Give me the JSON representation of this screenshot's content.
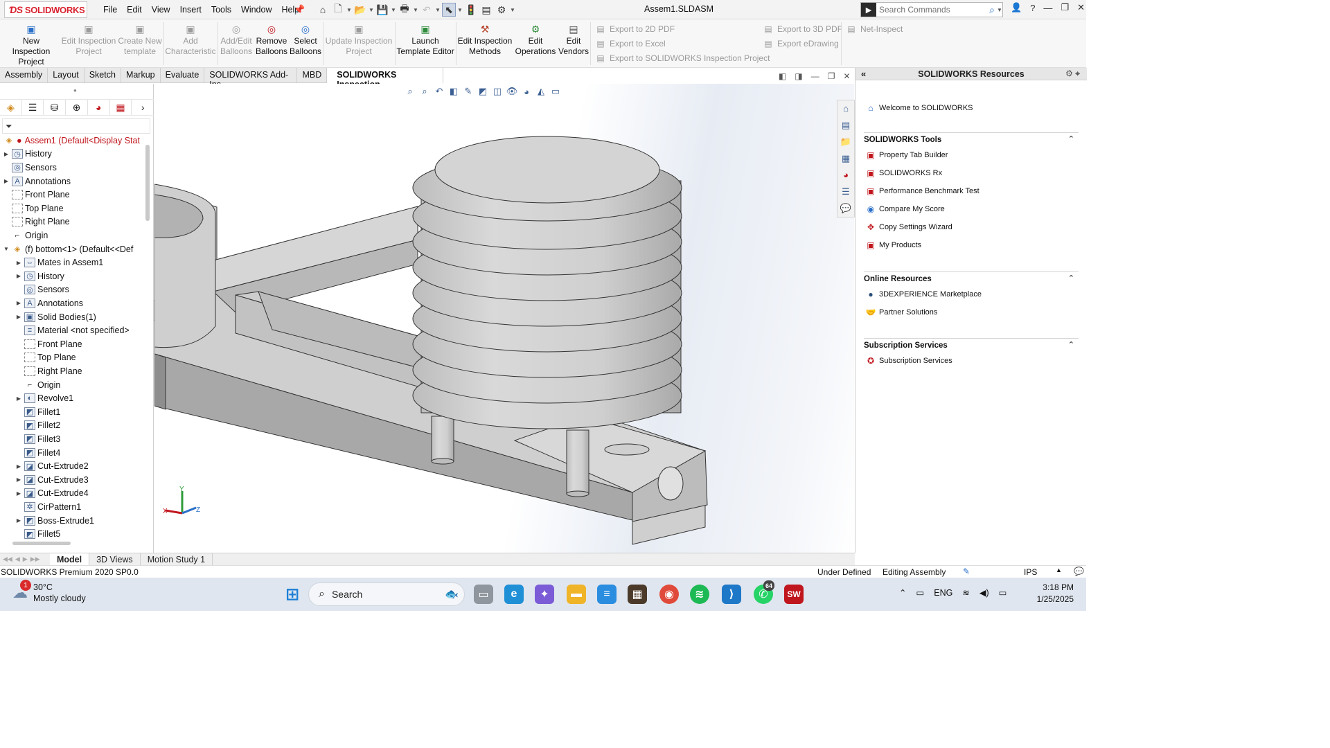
{
  "title_bar": {
    "logo_text": "SOLIDWORKS",
    "menus": [
      "File",
      "Edit",
      "View",
      "Insert",
      "Tools",
      "Window",
      "Help"
    ],
    "document_title": "Assem1.SLDASM",
    "search_placeholder": "Search Commands"
  },
  "command_manager": {
    "buttons": [
      {
        "label": "New Inspection Project",
        "line1": "New Inspection",
        "line2": "Project",
        "enabled": true
      },
      {
        "label": "Edit Inspection Project",
        "line1": "Edit Inspection",
        "line2": "Project",
        "enabled": false
      },
      {
        "label": "Create New template",
        "line1": "Create New",
        "line2": "template",
        "enabled": false
      },
      {
        "label": "Add Characteristic",
        "line1": "Add",
        "line2": "Characteristic",
        "enabled": false
      },
      {
        "label": "Add/Edit Balloons",
        "line1": "Add/Edit",
        "line2": "Balloons",
        "enabled": false
      },
      {
        "label": "Remove Balloons",
        "line1": "Remove",
        "line2": "Balloons",
        "enabled": true
      },
      {
        "label": "Select Balloons",
        "line1": "Select",
        "line2": "Balloons",
        "enabled": true
      },
      {
        "label": "Update Inspection Project",
        "line1": "Update Inspection",
        "line2": "Project",
        "enabled": false
      },
      {
        "label": "Launch Template Editor",
        "line1": "Launch",
        "line2": "Template Editor",
        "enabled": true
      },
      {
        "label": "Edit Inspection Methods",
        "line1": "Edit Inspection",
        "line2": "Methods",
        "enabled": true
      },
      {
        "label": "Edit Operations",
        "line1": "Edit",
        "line2": "Operations",
        "enabled": true
      },
      {
        "label": "Edit Vendors",
        "line1": "Edit",
        "line2": "Vendors",
        "enabled": true
      }
    ],
    "export_col1": [
      "Export to 2D PDF",
      "Export to Excel",
      "Export to SOLIDWORKS Inspection Project"
    ],
    "export_col2": [
      "Export to 3D PDF",
      "Export eDrawing"
    ],
    "net_inspect": "Net-Inspect"
  },
  "tabs": [
    "Assembly",
    "Layout",
    "Sketch",
    "Markup",
    "Evaluate",
    "SOLIDWORKS Add-Ins",
    "MBD",
    "SOLIDWORKS Inspection"
  ],
  "active_tab": "SOLIDWORKS Inspection",
  "feature_tree": {
    "root": "Assem1  (Default<Display Stat",
    "items": [
      {
        "label": "History",
        "indent": 1,
        "expand": true,
        "icon": "history-icon"
      },
      {
        "label": "Sensors",
        "indent": 1,
        "expand": false,
        "icon": "sensor-icon"
      },
      {
        "label": "Annotations",
        "indent": 1,
        "expand": true,
        "icon": "annotation-icon"
      },
      {
        "label": "Front Plane",
        "indent": 1,
        "expand": false,
        "icon": "plane-icon"
      },
      {
        "label": "Top Plane",
        "indent": 1,
        "expand": false,
        "icon": "plane-icon"
      },
      {
        "label": "Right Plane",
        "indent": 1,
        "expand": false,
        "icon": "plane-icon"
      },
      {
        "label": "Origin",
        "indent": 1,
        "expand": false,
        "icon": "origin-icon"
      },
      {
        "label": "(f) bottom<1> (Default<<Def",
        "indent": 1,
        "expand": true,
        "icon": "part-icon",
        "open": true
      },
      {
        "label": "Mates in Assem1",
        "indent": 2,
        "expand": true,
        "icon": "mates-icon"
      },
      {
        "label": "History",
        "indent": 2,
        "expand": true,
        "icon": "history-icon"
      },
      {
        "label": "Sensors",
        "indent": 2,
        "expand": false,
        "icon": "sensor-icon"
      },
      {
        "label": "Annotations",
        "indent": 2,
        "expand": true,
        "icon": "annotation-icon"
      },
      {
        "label": "Solid Bodies(1)",
        "indent": 2,
        "expand": true,
        "icon": "solid-bodies-icon"
      },
      {
        "label": "Material <not specified>",
        "indent": 2,
        "expand": false,
        "icon": "material-icon"
      },
      {
        "label": "Front Plane",
        "indent": 2,
        "expand": false,
        "icon": "plane-icon"
      },
      {
        "label": "Top Plane",
        "indent": 2,
        "expand": false,
        "icon": "plane-icon"
      },
      {
        "label": "Right Plane",
        "indent": 2,
        "expand": false,
        "icon": "plane-icon"
      },
      {
        "label": "Origin",
        "indent": 2,
        "expand": false,
        "icon": "origin-icon"
      },
      {
        "label": "Revolve1",
        "indent": 2,
        "expand": true,
        "icon": "revolve-icon"
      },
      {
        "label": "Fillet1",
        "indent": 2,
        "expand": false,
        "icon": "fillet-icon"
      },
      {
        "label": "Fillet2",
        "indent": 2,
        "expand": false,
        "icon": "fillet-icon"
      },
      {
        "label": "Fillet3",
        "indent": 2,
        "expand": false,
        "icon": "fillet-icon"
      },
      {
        "label": "Fillet4",
        "indent": 2,
        "expand": false,
        "icon": "fillet-icon"
      },
      {
        "label": "Cut-Extrude2",
        "indent": 2,
        "expand": true,
        "icon": "cut-extrude-icon"
      },
      {
        "label": "Cut-Extrude3",
        "indent": 2,
        "expand": true,
        "icon": "cut-extrude-icon"
      },
      {
        "label": "Cut-Extrude4",
        "indent": 2,
        "expand": true,
        "icon": "cut-extrude-icon"
      },
      {
        "label": "CirPattern1",
        "indent": 2,
        "expand": false,
        "icon": "circular-pattern-icon"
      },
      {
        "label": "Boss-Extrude1",
        "indent": 2,
        "expand": true,
        "icon": "boss-extrude-icon"
      },
      {
        "label": "Fillet5",
        "indent": 2,
        "expand": false,
        "icon": "fillet-icon"
      }
    ]
  },
  "resources": {
    "title": "SOLIDWORKS Resources",
    "welcome": "Welcome to SOLIDWORKS",
    "sections": [
      {
        "title": "SOLIDWORKS Tools",
        "items": [
          "Property Tab Builder",
          "SOLIDWORKS Rx",
          "Performance Benchmark Test",
          "Compare My Score",
          "Copy Settings Wizard",
          "My Products"
        ]
      },
      {
        "title": "Online Resources",
        "items": [
          "3DEXPERIENCE Marketplace",
          "Partner Solutions"
        ]
      },
      {
        "title": "Subscription Services",
        "items": [
          "Subscription Services"
        ]
      }
    ]
  },
  "bottom_tabs": [
    "Model",
    "3D Views",
    "Motion Study 1"
  ],
  "active_bottom_tab": "Model",
  "status_bar": {
    "left": "SOLIDWORKS Premium 2020 SP0.0",
    "under_defined": "Under Defined",
    "editing": "Editing Assembly",
    "units": "IPS"
  },
  "taskbar": {
    "weather_temp": "30°C",
    "weather_text": "Mostly cloudy",
    "weather_badge": "1",
    "search_label": "Search",
    "language": "ENG",
    "time": "3:18 PM",
    "date": "1/25/2025",
    "whatsapp_badge": "64"
  },
  "colors": {
    "brand_red": "#d8212e",
    "accent_blue": "#2a6fc9"
  }
}
